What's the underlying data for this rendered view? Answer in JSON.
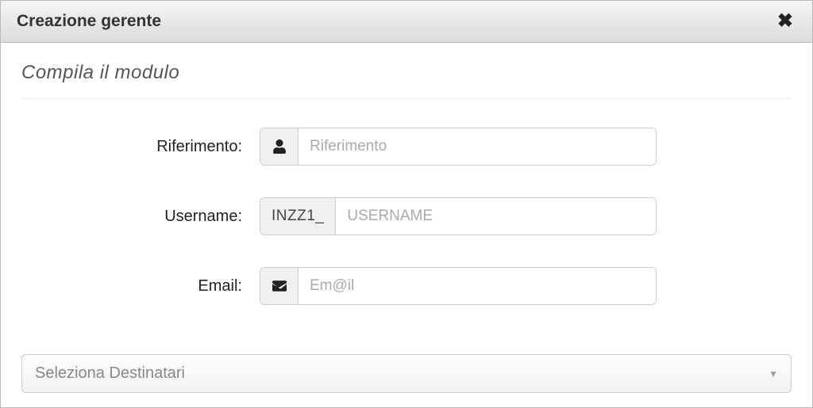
{
  "dialog": {
    "title": "Creazione gerente"
  },
  "form": {
    "subtitle": "Compila il modulo",
    "riferimento": {
      "label": "Riferimento:",
      "placeholder": "Riferimento",
      "value": ""
    },
    "username": {
      "label": "Username:",
      "prefix": "INZZ1_",
      "placeholder": "USERNAME",
      "value": ""
    },
    "email": {
      "label": "Email:",
      "placeholder": "Em@il",
      "value": ""
    },
    "destinatari": {
      "placeholder": "Seleziona Destinatari"
    }
  }
}
